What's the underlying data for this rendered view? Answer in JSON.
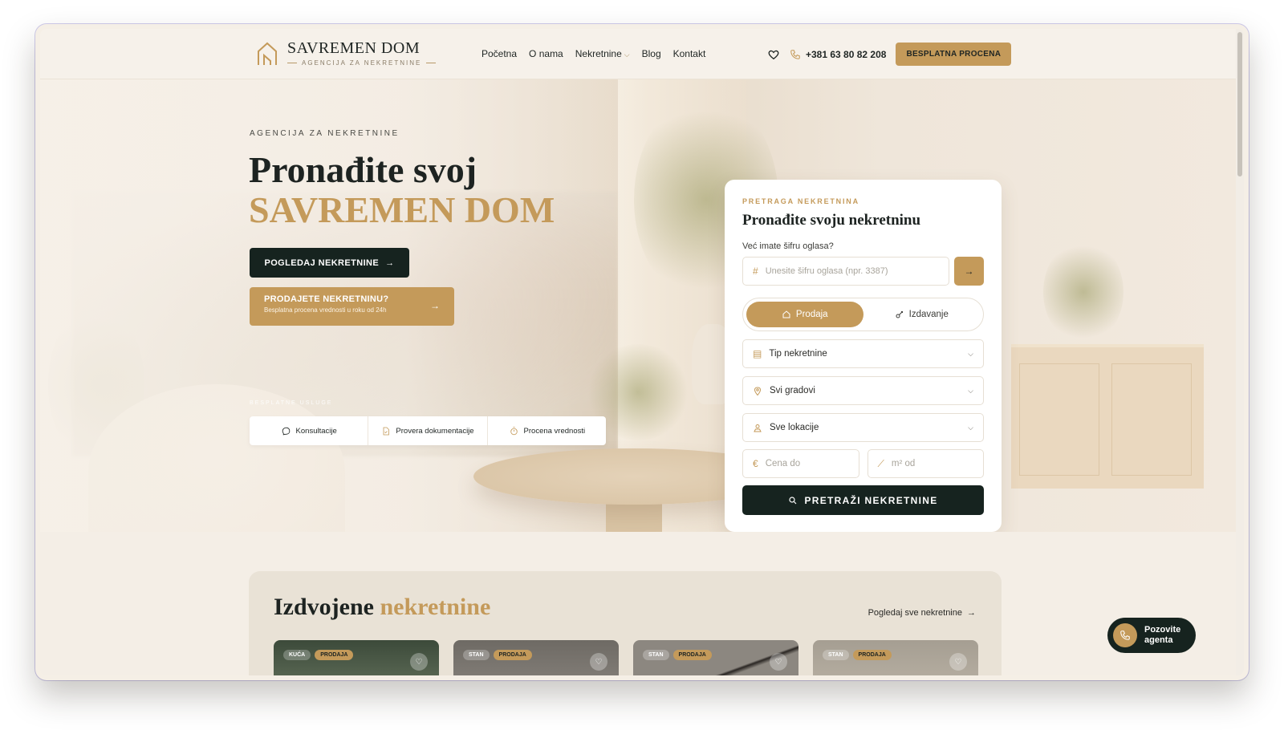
{
  "header": {
    "logo_title": "SAVREMEN DOM",
    "logo_sub": "AGENCIJA ZA NEKRETNINE",
    "nav": [
      "Početna",
      "O nama",
      "Nekretnine",
      "Blog",
      "Kontakt"
    ],
    "phone": "+381 63 80 82 208",
    "cta": "BESPLATNA PROCENA"
  },
  "hero": {
    "eyebrow": "AGENCIJA ZA NEKRETNINE",
    "title_line1": "Pronađite svoj",
    "title_line2": "SAVREMEN DOM",
    "btn_primary": "POGLEDAJ NEKRETNINE",
    "btn_secondary_title": "PRODAJETE NEKRETNINU?",
    "btn_secondary_sub": "Besplatna procena vrednosti u roku od 24h",
    "services_label": "BESPLATNE USLUGE",
    "services": [
      "Konsultacije",
      "Provera dokumentacije",
      "Procena vrednosti"
    ]
  },
  "search": {
    "eyebrow": "PRETRAGA NEKRETNINA",
    "title": "Pronađite svoju nekretninu",
    "code_question": "Već imate šifru oglasa?",
    "code_placeholder": "Unesite šifru oglasa (npr. 3387)",
    "tab_sale": "Prodaja",
    "tab_rent": "Izdavanje",
    "type_select": "Tip nekretnine",
    "city_select": "Svi gradovi",
    "location_select": "Sve lokacije",
    "price_placeholder": "Cena do",
    "area_placeholder": "m² od",
    "submit": "PRETRAŽI NEKRETNINE"
  },
  "featured": {
    "title_part1": "Izdvojene",
    "title_part2": "nekretnine",
    "link": "Pogledaj sve nekretnine",
    "cards": [
      {
        "type": "KUĆA",
        "deal": "PRODAJA",
        "bg": "#3c4a3a"
      },
      {
        "type": "STAN",
        "deal": "PRODAJA",
        "bg": "#6e6a64"
      },
      {
        "type": "STAN",
        "deal": "PRODAJA",
        "bg": "#8c8780"
      },
      {
        "type": "STAN",
        "deal": "PRODAJA",
        "bg": "#a59e92"
      }
    ]
  },
  "agent": {
    "label_line1": "Pozovite",
    "label_line2": "agenta"
  },
  "colors": {
    "accent": "#c49a5a",
    "dark": "#16231f",
    "background": "#f4eee6"
  }
}
